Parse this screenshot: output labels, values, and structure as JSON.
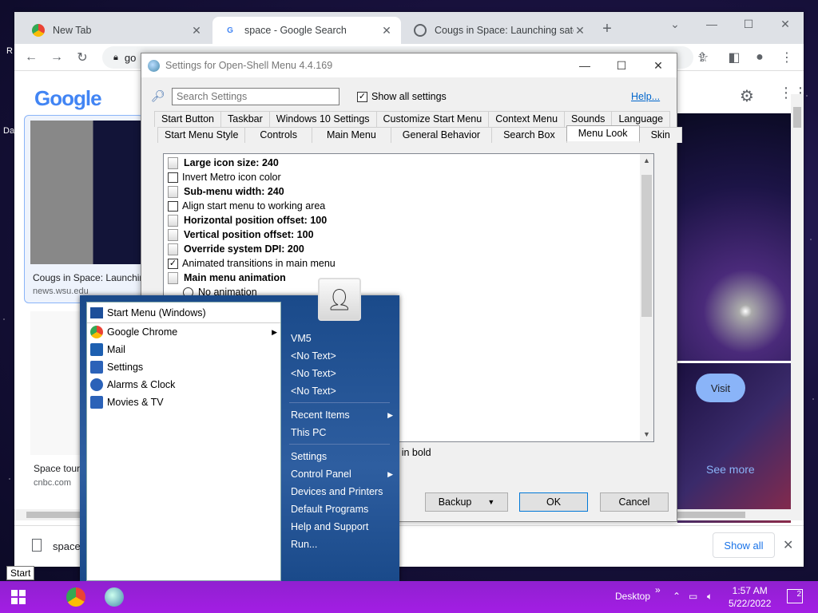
{
  "desktop": {
    "labels": [
      "R",
      "Da"
    ]
  },
  "chrome": {
    "tabs": [
      {
        "title": "New Tab",
        "icon": "chrome-icon"
      },
      {
        "title": "space - Google Search",
        "icon": "google-icon"
      },
      {
        "title": "Cougs in Space: Launching satell",
        "icon": "globe-icon"
      }
    ],
    "new_tab": "+",
    "omnibox_text": "go",
    "logo_text": "Google",
    "result_card_1": {
      "title": "Cougs in Space: Launchin",
      "source": "news.wsu.edu"
    },
    "result_card_2": {
      "title": "Space tour",
      "source": "cnbc.com"
    },
    "visit_label": "Visit",
    "see_more_label": "See more",
    "download": {
      "file_name": "space",
      "show_all": "Show all"
    }
  },
  "dialog": {
    "title": "Settings for Open-Shell Menu 4.4.169",
    "search_placeholder": "Search Settings",
    "show_all_settings": "Show all settings",
    "show_all_checked": true,
    "help": "Help...",
    "tabs_row1": [
      "Start Button",
      "Taskbar",
      "Windows 10 Settings",
      "Customize Start Menu",
      "Context Menu",
      "Sounds",
      "Language"
    ],
    "tabs_row2": [
      "Start Menu Style",
      "Controls",
      "Main Menu",
      "General Behavior",
      "Search Box",
      "Menu Look",
      "Skin"
    ],
    "selected_tab": "Menu Look",
    "settings": [
      {
        "label": "Large icon size: 240",
        "kind": "page",
        "bold": true
      },
      {
        "label": "Invert Metro icon color",
        "kind": "checkbox",
        "checked": false
      },
      {
        "label": "Sub-menu width: 240",
        "kind": "page",
        "bold": true
      },
      {
        "label": "Align start menu to working area",
        "kind": "checkbox",
        "checked": false
      },
      {
        "label": "Horizontal position offset: 100",
        "kind": "page",
        "bold": true
      },
      {
        "label": "Vertical position offset: 100",
        "kind": "page",
        "bold": true
      },
      {
        "label": "Override system DPI: 200",
        "kind": "page",
        "bold": true
      },
      {
        "label": "Animated transitions in main menu",
        "kind": "checkbox",
        "checked": true
      },
      {
        "label": "Main menu animation",
        "kind": "page",
        "bold": true
      },
      {
        "label": "No animation",
        "kind": "radio"
      }
    ],
    "description_fragment": "y in bold",
    "buttons": {
      "backup": "Backup",
      "ok": "OK",
      "cancel": "Cancel"
    }
  },
  "start_menu": {
    "header": "Start Menu (Windows)",
    "left_items": [
      {
        "label": "Google Chrome",
        "icon": "chrome-icon",
        "submenu": true,
        "color": "#e94235"
      },
      {
        "label": "Mail",
        "icon": "mail-icon",
        "submenu": false,
        "color": "#1d5fb0"
      },
      {
        "label": "Settings",
        "icon": "gear-icon",
        "submenu": false,
        "color": "#2b62b8"
      },
      {
        "label": "Alarms & Clock",
        "icon": "clock-icon",
        "submenu": false,
        "color": "#2b62b8"
      },
      {
        "label": "Movies & TV",
        "icon": "film-icon",
        "submenu": false,
        "color": "#2b62b8"
      }
    ],
    "right_items": [
      {
        "label": "VM5",
        "submenu": false
      },
      {
        "label": "<No Text>",
        "submenu": false
      },
      {
        "label": "<No Text>",
        "submenu": false
      },
      {
        "label": "<No Text>",
        "submenu": false
      },
      {
        "label": "Recent Items",
        "submenu": true
      },
      {
        "label": "This PC",
        "submenu": false
      },
      {
        "label": "Settings",
        "submenu": false
      },
      {
        "label": "Control Panel",
        "submenu": true
      },
      {
        "label": "Devices and Printers",
        "submenu": false
      },
      {
        "label": "Default Programs",
        "submenu": false
      },
      {
        "label": "Help and Support",
        "submenu": false
      },
      {
        "label": "Run...",
        "submenu": false
      }
    ]
  },
  "tooltip": "Start",
  "taskbar": {
    "desktop_label": "Desktop",
    "time": "1:57 AM",
    "date": "5/22/2022",
    "notifications": "2",
    "color": "#a31de0"
  }
}
